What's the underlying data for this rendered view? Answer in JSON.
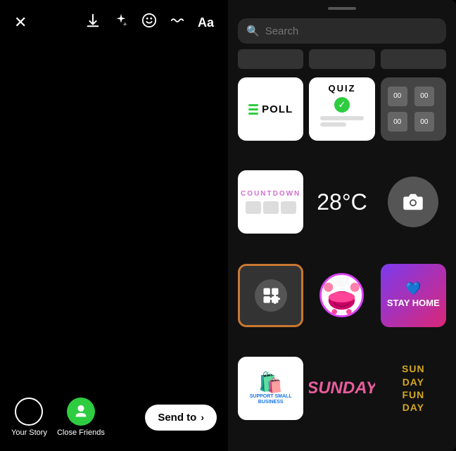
{
  "left_panel": {
    "close_label": "✕",
    "icons": [
      "download",
      "sparkle",
      "face",
      "wave",
      "Aa"
    ],
    "bottom": {
      "your_story_label": "Your Story",
      "close_friends_label": "Close Friends",
      "send_to_label": "Send to"
    }
  },
  "right_panel": {
    "search_placeholder": "Search",
    "categories": [
      "",
      "",
      ""
    ],
    "stickers": [
      {
        "id": "poll",
        "type": "poll",
        "text": "POLL"
      },
      {
        "id": "quiz",
        "type": "quiz",
        "text": "QUIZ"
      },
      {
        "id": "numgrid",
        "type": "numgrid",
        "text": ""
      },
      {
        "id": "countdown",
        "type": "countdown",
        "text": "COUNTDOWN"
      },
      {
        "id": "temperature",
        "type": "temperature",
        "text": "28°C"
      },
      {
        "id": "camera",
        "type": "camera",
        "text": ""
      },
      {
        "id": "addmedia",
        "type": "addmedia",
        "text": ""
      },
      {
        "id": "mouth",
        "type": "mouth",
        "text": ""
      },
      {
        "id": "stayhome",
        "type": "stayhome",
        "text": "STAY HOME"
      },
      {
        "id": "ssb",
        "type": "ssb",
        "text": "SUPPORT SMALL BUSINESS"
      },
      {
        "id": "sunday",
        "type": "sunday",
        "text": "SUNDAY"
      },
      {
        "id": "sundayfunday",
        "type": "sundayfunday",
        "text": "SUN\nDAY\nFUN\nDAY"
      }
    ]
  }
}
